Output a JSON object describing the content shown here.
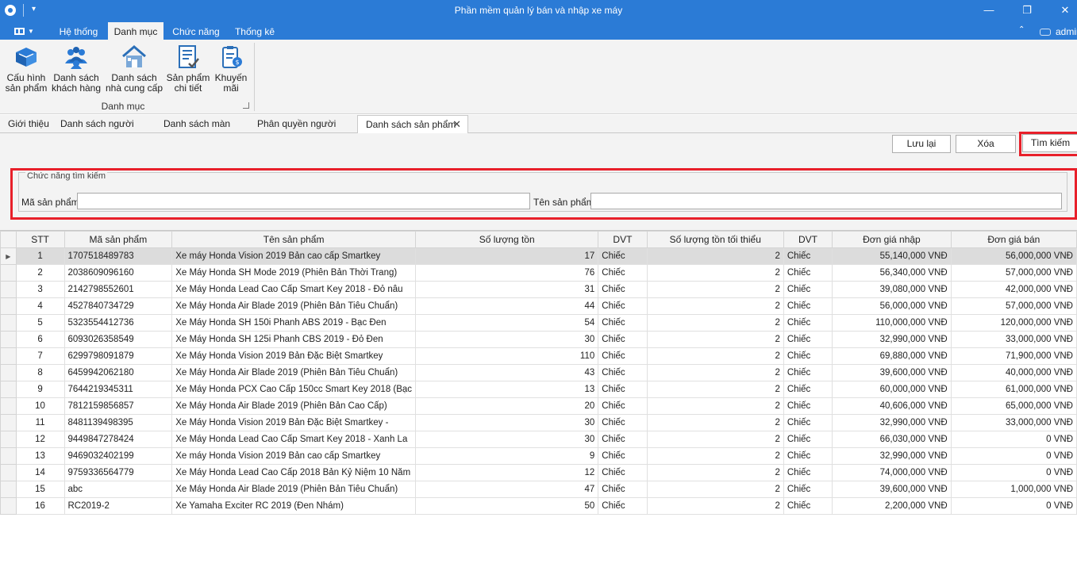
{
  "window": {
    "title": "Phần mềm quản lý bán và nhập xe máy",
    "quick_access": "▾",
    "controls": {
      "minimize": "—",
      "restore": "❐",
      "close": "✕"
    }
  },
  "ribbon_tabs": {
    "items": [
      {
        "label": "Hệ thống",
        "active": false
      },
      {
        "label": "Danh mục",
        "active": true
      },
      {
        "label": "Chức năng",
        "active": false
      },
      {
        "label": "Thống kê",
        "active": false
      }
    ],
    "collapse_glyph": "⌃",
    "user": "admin"
  },
  "ribbon": {
    "group_label": "Danh mục",
    "buttons": [
      {
        "label": "Cấu hình\nsản phẩm",
        "icon": "box-config-icon"
      },
      {
        "label": "Danh sách\nkhách hàng",
        "icon": "customers-icon"
      },
      {
        "label": "Danh sách\nnhà cung cấp",
        "icon": "supplier-house-icon"
      },
      {
        "label": "Sản phẩm\nchi tiết",
        "icon": "product-detail-icon"
      },
      {
        "label": "Khuyến\nmãi",
        "icon": "promotion-icon"
      }
    ]
  },
  "doc_tabs": {
    "items": [
      {
        "label": "Giới thiệu"
      },
      {
        "label": "Danh sách người dùng"
      },
      {
        "label": "Danh sách màn hình"
      },
      {
        "label": "Phân quyền người dùng"
      },
      {
        "label": "Danh sách sản phẩm",
        "active": true
      }
    ],
    "close_glyph": "✕"
  },
  "actions": {
    "save": "Lưu lại",
    "delete": "Xóa",
    "search": "Tìm kiếm"
  },
  "search": {
    "legend": "Chức năng tìm kiếm",
    "code_label": "Mã sản phẩm",
    "code_value": "",
    "name_label": "Tên sản phẩm",
    "name_value": ""
  },
  "table": {
    "columns": [
      "STT",
      "Mã sản phẩm",
      "Tên sản phẩm",
      "Số lượng tồn",
      "DVT",
      "Số lượng tồn tối thiểu",
      "DVT",
      "Đơn giá nhập",
      "Đơn giá bán"
    ],
    "rows": [
      [
        "1",
        "1707518489783",
        "Xe máy Honda Vision 2019 Bản cao cấp Smartkey",
        "17",
        "Chiếc",
        "2",
        "Chiếc",
        "55,140,000 VNĐ",
        "56,000,000 VNĐ"
      ],
      [
        "2",
        "2038609096160",
        "Xe Máy Honda SH Mode 2019 (Phiên Bản Thời Trang)",
        "76",
        "Chiếc",
        "2",
        "Chiếc",
        "56,340,000 VNĐ",
        "57,000,000 VNĐ"
      ],
      [
        "3",
        "2142798552601",
        " Xe Máy Honda Lead Cao Cấp Smart Key 2018 - Đỏ nâu",
        "31",
        "Chiếc",
        "2",
        "Chiếc",
        "39,080,000 VNĐ",
        "42,000,000 VNĐ"
      ],
      [
        "4",
        "4527840734729",
        "Xe Máy Honda Air Blade 2019 (Phiên Bản Tiêu Chuẩn)",
        "44",
        "Chiếc",
        "2",
        "Chiếc",
        "56,000,000 VNĐ",
        "57,000,000 VNĐ"
      ],
      [
        "5",
        "5323554412736",
        "Xe Máy Honda SH 150i Phanh ABS 2019 - Bạc Đen",
        "54",
        "Chiếc",
        "2",
        "Chiếc",
        "110,000,000 VNĐ",
        "120,000,000 VNĐ"
      ],
      [
        "6",
        "6093026358549",
        "Xe Máy Honda SH 125i Phanh CBS 2019 - Đỏ Đen",
        "30",
        "Chiếc",
        "2",
        "Chiếc",
        "32,990,000 VNĐ",
        "33,000,000 VNĐ"
      ],
      [
        "7",
        "6299798091879",
        "Xe Máy Honda Vision 2019 Bản Đặc Biệt Smartkey",
        "110",
        "Chiếc",
        "2",
        "Chiếc",
        "69,880,000 VNĐ",
        "71,900,000 VNĐ"
      ],
      [
        "8",
        "6459942062180",
        "Xe Máy Honda Air Blade 2019 (Phiên Bản Tiêu Chuẩn)",
        "43",
        "Chiếc",
        "2",
        "Chiếc",
        "39,600,000 VNĐ",
        "40,000,000 VNĐ"
      ],
      [
        "9",
        "7644219345311",
        "Xe Máy Honda PCX Cao Cấp 150cc Smart Key 2018 (Bạc",
        "13",
        "Chiếc",
        "2",
        "Chiếc",
        "60,000,000 VNĐ",
        "61,000,000 VNĐ"
      ],
      [
        "10",
        "7812159856857",
        "Xe Máy Honda Air Blade 2019 (Phiên Bản Cao Cấp)",
        "20",
        "Chiếc",
        "2",
        "Chiếc",
        "40,606,000 VNĐ",
        "65,000,000 VNĐ"
      ],
      [
        "11",
        "8481139498395",
        "Xe Máy Honda Vision 2019 Bản Đặc Biệt Smartkey -",
        "30",
        "Chiếc",
        "2",
        "Chiếc",
        "32,990,000 VNĐ",
        "33,000,000 VNĐ"
      ],
      [
        "12",
        "9449847278424",
        "Xe Máy Honda Lead Cao Cấp Smart Key 2018 - Xanh La",
        "30",
        "Chiếc",
        "2",
        "Chiếc",
        "66,030,000 VNĐ",
        "0 VNĐ"
      ],
      [
        "13",
        "9469032402199",
        "Xe máy Honda Vision 2019 Bản cao cấp Smartkey",
        "9",
        "Chiếc",
        "2",
        "Chiếc",
        "32,990,000 VNĐ",
        "0 VNĐ"
      ],
      [
        "14",
        "9759336564779",
        "Xe Máy Honda Lead Cao Cấp 2018 Bản Kỷ Niệm 10 Năm",
        "12",
        "Chiếc",
        "2",
        "Chiếc",
        "74,000,000 VNĐ",
        "0 VNĐ"
      ],
      [
        "15",
        "abc",
        "Xe Máy Honda Air Blade 2019 (Phiên Bản Tiêu Chuẩn)",
        "47",
        "Chiếc",
        "2",
        "Chiếc",
        "39,600,000 VNĐ",
        "1,000,000 VNĐ"
      ],
      [
        "16",
        "RC2019-2",
        "Xe Yamaha Exciter RC 2019 (Đen Nhám)",
        "50",
        "Chiếc",
        "2",
        "Chiếc",
        "2,200,000 VNĐ",
        "0 VNĐ"
      ]
    ],
    "selected_row": 0,
    "row_indicator": "▶"
  },
  "colors": {
    "titlebar": "#2b7bd6",
    "highlight": "#e8202a",
    "ribbon_bg": "#f3f3f3"
  }
}
